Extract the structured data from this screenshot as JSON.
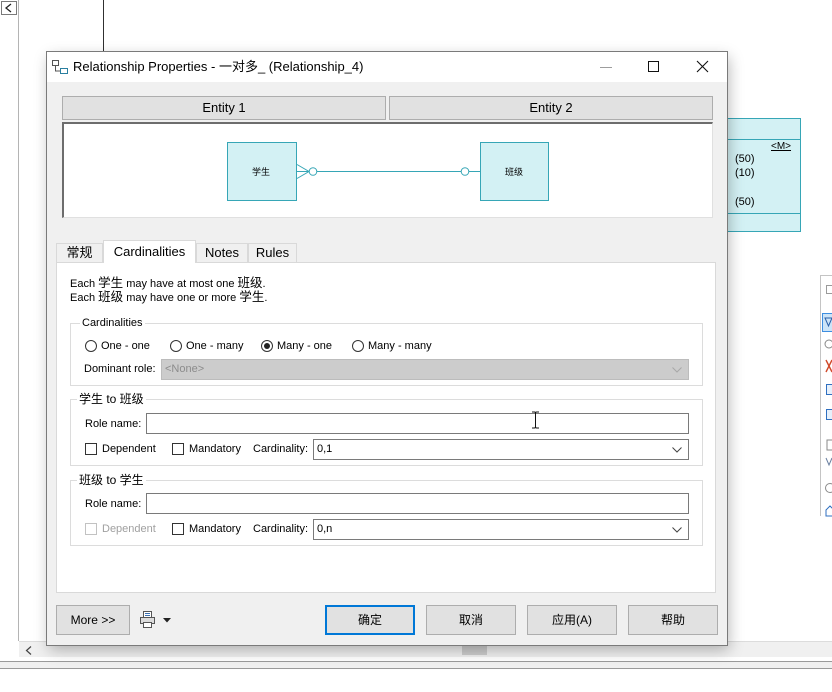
{
  "window": {
    "title": "Relationship Properties - 一对多_ (Relationship_4)",
    "icon": "relationship-properties-icon",
    "controls": [
      "minimize-icon",
      "maximize-icon",
      "close-icon"
    ]
  },
  "entity_headers": [
    "Entity 1",
    "Entity 2"
  ],
  "diagram": {
    "entity1": "学生",
    "entity2": "班级"
  },
  "tabs": [
    {
      "label": "常规",
      "selected": false
    },
    {
      "label": "Cardinalities",
      "selected": true
    },
    {
      "label": "Notes",
      "selected": false
    },
    {
      "label": "Rules",
      "selected": false
    }
  ],
  "description": [
    {
      "a": "Each ",
      "e1": "学生",
      "b": " may have at most one ",
      "e2": "班级",
      "c": "."
    },
    {
      "a": "Each ",
      "e1": "班级",
      "b": " may have one or more ",
      "e2": "学生",
      "c": "."
    }
  ],
  "cardinalities": {
    "label": "Cardinalities",
    "options": [
      "One - one",
      "One - many",
      "Many - one",
      "Many - many"
    ],
    "selected_index": 2,
    "dominant_role_label": "Dominant role:",
    "dominant_role_value": "<None>",
    "dominant_role_enabled": false
  },
  "roles": [
    {
      "label": "学生 to 班级",
      "role_name_label": "Role name:",
      "role_name_value": "",
      "dependent_label": "Dependent",
      "dependent_checked": false,
      "dependent_enabled": true,
      "mandatory_label": "Mandatory",
      "mandatory_checked": false,
      "cardinality_label": "Cardinality:",
      "cardinality_value": "0,1"
    },
    {
      "label": "班级 to 学生",
      "role_name_label": "Role name:",
      "role_name_value": "",
      "dependent_label": "Dependent",
      "dependent_checked": false,
      "dependent_enabled": false,
      "mandatory_label": "Mandatory",
      "mandatory_checked": false,
      "cardinality_label": "Cardinality:",
      "cardinality_value": "0,n"
    }
  ],
  "buttons": {
    "more": "More >>",
    "print_icon": "printer-icon",
    "ok": "确定",
    "cancel": "取消",
    "apply": "应用(A)",
    "help": "帮助"
  },
  "background": {
    "right_entity": {
      "marker": "<M>",
      "values": [
        "(50)",
        "(10)",
        "(50)"
      ]
    },
    "palette_icons": [
      "grid-icon",
      "pointer-icon",
      "zoom-icon",
      "delete-icon",
      "entity-icon",
      "view-icon",
      "inheritance-icon",
      "link-icon",
      "ellipse-icon",
      "package-icon"
    ]
  },
  "colors": {
    "accent": "#0078d7",
    "entity_fill": "#d3f1f4",
    "entity_border": "#36a6b6",
    "disabled_field": "#cccccc"
  }
}
